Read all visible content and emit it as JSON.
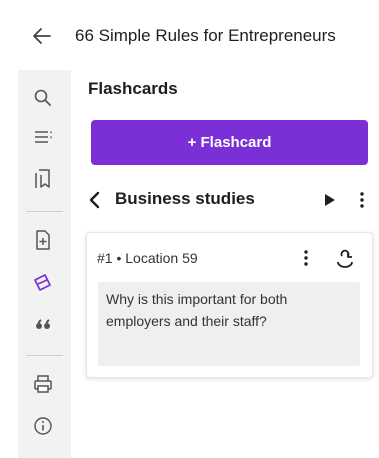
{
  "header": {
    "title": "66 Simple Rules for Entrepreneurs",
    "back_icon": "back-arrow-icon"
  },
  "sidebar": {
    "items": [
      {
        "name": "search",
        "icon": "search-icon"
      },
      {
        "name": "contents",
        "icon": "table-of-contents-icon"
      },
      {
        "name": "bookmarks",
        "icon": "bookmark-icon"
      },
      {
        "name": "add-page",
        "icon": "add-page-icon"
      },
      {
        "name": "flashcards",
        "icon": "flashcards-icon",
        "active": true
      },
      {
        "name": "quotes",
        "icon": "quote-icon"
      },
      {
        "name": "print",
        "icon": "print-icon"
      },
      {
        "name": "info",
        "icon": "info-icon"
      }
    ],
    "active_color": "#7b2fd6"
  },
  "panel": {
    "title": "Flashcards",
    "add_button_label": "+ Flashcard",
    "accent_color": "#7b2fd6",
    "deck": {
      "name": "Business studies"
    }
  },
  "card": {
    "location": "#1 • Location 59",
    "text": "Why is this important for both employers and their staff?"
  }
}
